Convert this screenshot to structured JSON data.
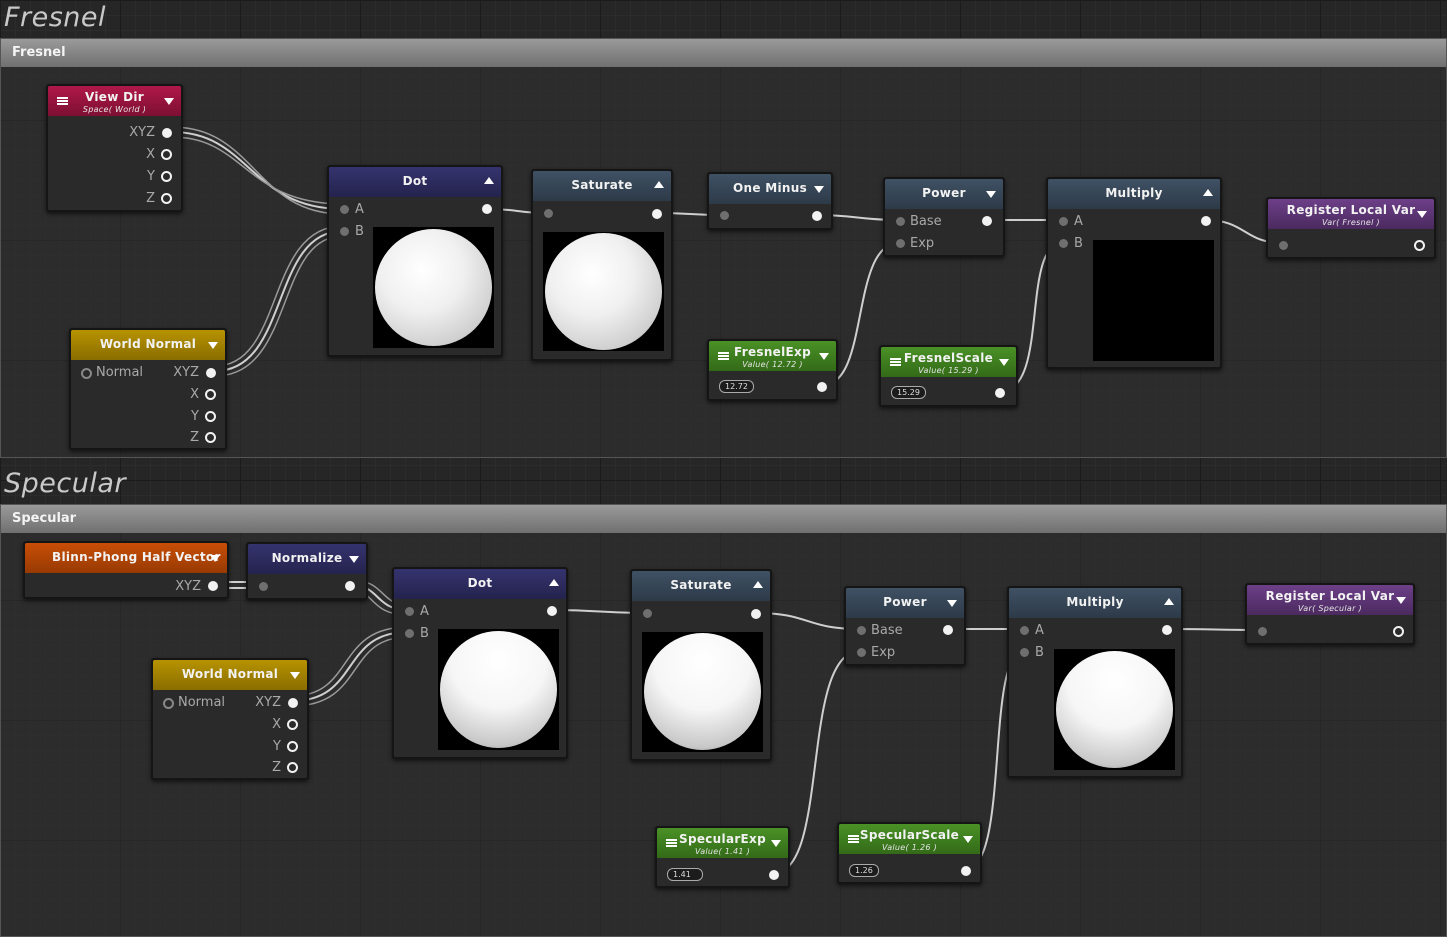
{
  "groups": {
    "fresnel": {
      "title": "Fresnel",
      "header": "Fresnel"
    },
    "specular": {
      "title": "Specular",
      "header": "Specular"
    }
  },
  "fresnel_nodes": {
    "view_dir": {
      "title": "View Dir",
      "sub": "Space( World )",
      "ports": [
        "XYZ",
        "X",
        "Y",
        "Z"
      ]
    },
    "world_normal": {
      "title": "World Normal",
      "input": "Normal",
      "ports": [
        "XYZ",
        "X",
        "Y",
        "Z"
      ]
    },
    "dot": {
      "title": "Dot",
      "in_a": "A",
      "in_b": "B"
    },
    "saturate": {
      "title": "Saturate"
    },
    "one_minus": {
      "title": "One Minus"
    },
    "power": {
      "title": "Power",
      "in_a": "Base",
      "in_b": "Exp"
    },
    "multiply": {
      "title": "Multiply",
      "in_a": "A",
      "in_b": "B"
    },
    "fresnel_exp": {
      "title": "FresnelExp",
      "sub": "Value( 12.72 )",
      "value": "12.72"
    },
    "fresnel_scale": {
      "title": "FresnelScale",
      "sub": "Value( 15.29 )",
      "value": "15.29"
    },
    "register": {
      "title": "Register Local Var",
      "sub": "Var( Fresnel )"
    }
  },
  "specular_nodes": {
    "blinn": {
      "title": "Blinn-Phong Half Vector",
      "port": "XYZ"
    },
    "normalize": {
      "title": "Normalize"
    },
    "world_normal": {
      "title": "World Normal",
      "input": "Normal",
      "ports": [
        "XYZ",
        "X",
        "Y",
        "Z"
      ]
    },
    "dot": {
      "title": "Dot",
      "in_a": "A",
      "in_b": "B"
    },
    "saturate": {
      "title": "Saturate"
    },
    "power": {
      "title": "Power",
      "in_a": "Base",
      "in_b": "Exp"
    },
    "multiply": {
      "title": "Multiply",
      "in_a": "A",
      "in_b": "B"
    },
    "specular_exp": {
      "title": "SpecularExp",
      "sub": "Value( 1.41 )",
      "value": "1.41"
    },
    "specular_scale": {
      "title": "SpecularScale",
      "sub": "Value( 1.26 )",
      "value": "1.26"
    },
    "register": {
      "title": "Register Local Var",
      "sub": "Var( Specular )"
    }
  },
  "colors": {
    "input_red": "#b0184a",
    "world_normal_yellow": "#b79300",
    "math_indigo": "#35336e",
    "math_slate": "#3f5164",
    "property_green": "#4a9126",
    "register_purple": "#6d3f88",
    "blinn_orange": "#c84e06"
  }
}
